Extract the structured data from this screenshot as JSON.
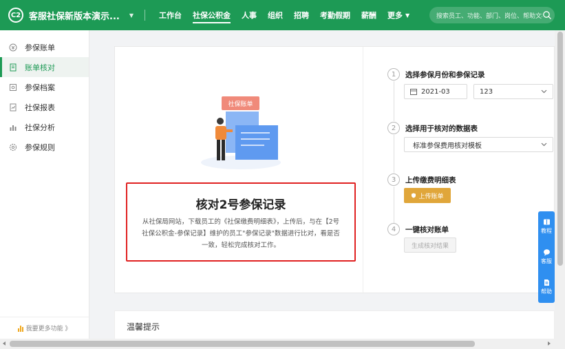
{
  "header": {
    "logo_text": "C2",
    "app_title": "客服社保新版本演示...",
    "nav": [
      {
        "label": "工作台"
      },
      {
        "label": "社保公积金"
      },
      {
        "label": "人事"
      },
      {
        "label": "组织"
      },
      {
        "label": "招聘"
      },
      {
        "label": "考勤假期"
      },
      {
        "label": "薪酬"
      },
      {
        "label": "更多"
      }
    ],
    "active_nav": "社保公积金",
    "search_placeholder": "搜索员工、功能、部门、岗位、帮助文档"
  },
  "sidebar": {
    "items": [
      {
        "label": "参保账单",
        "icon": "bill-icon"
      },
      {
        "label": "账单核对",
        "icon": "check-doc-icon"
      },
      {
        "label": "参保档案",
        "icon": "archive-icon"
      },
      {
        "label": "社保报表",
        "icon": "report-icon"
      },
      {
        "label": "社保分析",
        "icon": "bar-chart-icon"
      },
      {
        "label": "参保规则",
        "icon": "gear-icon"
      }
    ],
    "active_item": "账单核对",
    "footer_label": "我要更多功能 》"
  },
  "card": {
    "illustration_tag": "社保账单",
    "title": "核对2号参保记录",
    "description": "从社保局网站，下载员工的《社保缴费明细表》，上传后，与在【2号社保公积金-参保记录】维护的员工\"参保记录\"数据进行比对，看是否一致，轻松完成核对工作。",
    "steps": [
      {
        "num": "1",
        "title": "选择参保月份和参保记录",
        "month_value": "2021-03",
        "record_value": "123"
      },
      {
        "num": "2",
        "title": "选择用于核对的数据表",
        "template_value": "标准参保费用核对模板"
      },
      {
        "num": "3",
        "title": "上传缴费明细表",
        "button_label": "上传账单"
      },
      {
        "num": "4",
        "title": "一键核对账单",
        "button_label": "生成核对结果"
      }
    ]
  },
  "tips": {
    "title": "温馨提示"
  },
  "float_bar": [
    {
      "label": "教程",
      "icon": "book-icon"
    },
    {
      "label": "客服",
      "icon": "chat-icon"
    },
    {
      "label": "帮助",
      "icon": "doc-icon"
    }
  ],
  "colors": {
    "brand": "#1d9a55",
    "highlight_border": "#e02020",
    "upload_button": "#e0a63a",
    "float_bar": "#2f8ff0"
  }
}
